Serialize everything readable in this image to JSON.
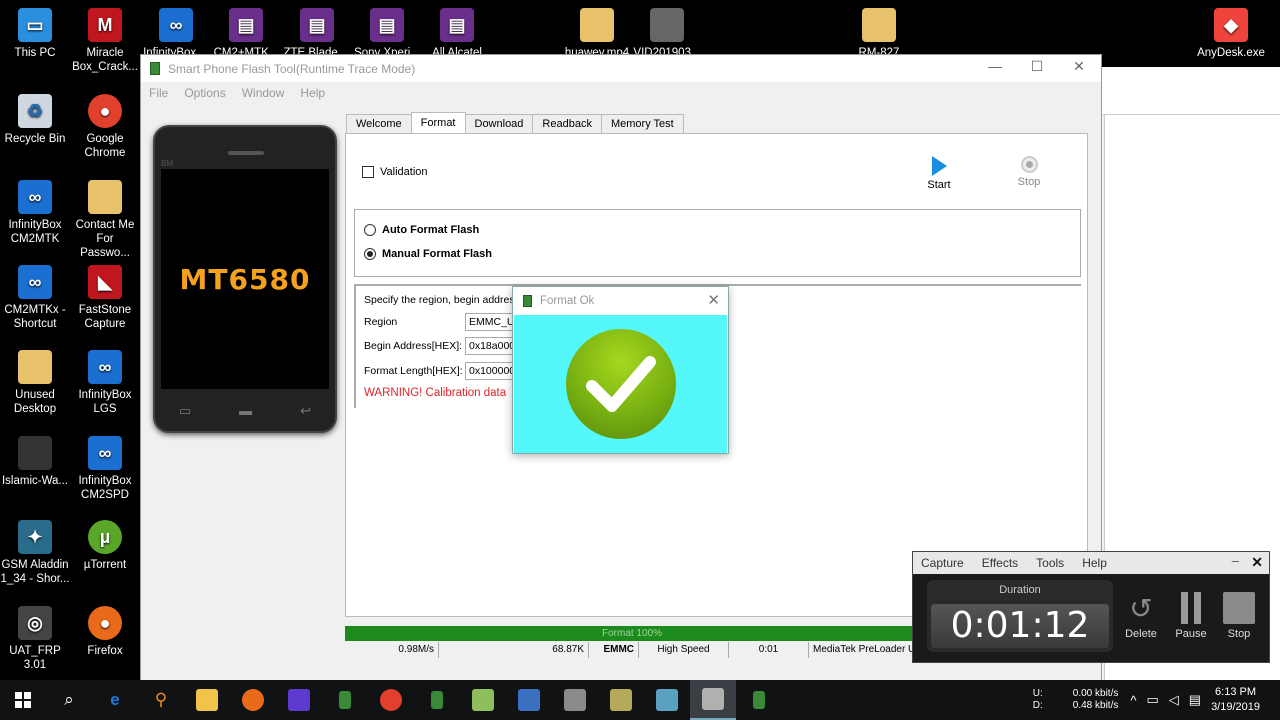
{
  "desktop": {
    "top_icons": [
      {
        "label": "This PC",
        "color": "#2b8fe0"
      },
      {
        "label": "Miracle Box_Crack...",
        "color": "#c0161f"
      },
      {
        "label": "InfinityBox ...",
        "color": "#1b6fd0"
      },
      {
        "label": "CM2+MTK...",
        "color": "#6a2f8a"
      },
      {
        "label": "ZTE Blade ...",
        "color": "#6a2f8a"
      },
      {
        "label": "Sony Xperi...",
        "color": "#6a2f8a"
      },
      {
        "label": "All Alcatel",
        "color": "#6a2f8a"
      },
      {
        "label": "huawey.mp4",
        "color": "#e8c26a"
      },
      {
        "label": "VID201903...",
        "color": "#666666"
      },
      {
        "label": "RM-827",
        "color": "#e8c26a"
      },
      {
        "label": "AnyDesk.exe",
        "color": "#ef443b"
      }
    ],
    "left_col1": [
      {
        "label": "Recycle Bin",
        "color": "#cfd8e0"
      },
      {
        "label": "InfinityBox CM2MTK",
        "color": "#1b6fd0"
      },
      {
        "label": "CM2MTKx - Shortcut",
        "color": "#1b6fd0"
      },
      {
        "label": "Unused Desktop",
        "color": "#e8c26a"
      },
      {
        "label": "Islamic-Wa...",
        "color": "#333333"
      },
      {
        "label": "GSM Aladdin 1_34 - Shor...",
        "color": "#2a6a8a"
      },
      {
        "label": "UAT_FRP 3.01",
        "color": "#444444"
      }
    ],
    "left_col2": [
      {
        "label": "Google Chrome",
        "color": "#e0402c"
      },
      {
        "label": "Contact Me For Passwo...",
        "color": "#e8c26a"
      },
      {
        "label": "FastStone Capture",
        "color": "#c0161f"
      },
      {
        "label": "InfinityBox LGS",
        "color": "#1b6fd0"
      },
      {
        "label": "InfinityBox CM2SPD",
        "color": "#1b6fd0"
      },
      {
        "label": "µTorrent",
        "color": "#5aa62a"
      },
      {
        "label": "Firefox",
        "color": "#e86a1a"
      }
    ]
  },
  "window": {
    "title": "Smart Phone Flash Tool(Runtime Trace Mode)",
    "menu": [
      "File",
      "Options",
      "Window",
      "Help"
    ],
    "phone_chip": "MT6580",
    "phone_brand": "BM",
    "tabs": [
      "Welcome",
      "Format",
      "Download",
      "Readback",
      "Memory Test"
    ],
    "validation_label": "Validation",
    "start_label": "Start",
    "stop_label": "Stop",
    "auto_format": "Auto Format Flash",
    "manual_format": "Manual Format Flash",
    "region_intro": "Specify the region, begin address",
    "region_label": "Region",
    "region_value": "EMMC_USE",
    "begin_label": "Begin Address[HEX]:",
    "begin_value": "0x18a000",
    "length_label": "Format Length[HEX]:",
    "length_value": "0x100000",
    "warning": "WARNING! Calibration data",
    "progress_text": "Format 100%",
    "progress_fraction": 1.0,
    "status": {
      "speed": "0.98M/s",
      "size": "68.87K",
      "storage": "EMMC",
      "mode": "High Speed",
      "time": "0:01",
      "port": "MediaTek PreLoader U"
    }
  },
  "dialog": {
    "title": "Format Ok",
    "bg_color": "#54f8fa"
  },
  "recorder": {
    "menu": [
      "Capture",
      "Effects",
      "Tools",
      "Help"
    ],
    "duration_label": "Duration",
    "time": "0:01:12",
    "delete_label": "Delete",
    "pause_label": "Pause",
    "stop_label": "Stop"
  },
  "taskbar": {
    "net_up_label": "U:",
    "net_up": "0.00 kbit/s",
    "net_down_label": "D:",
    "net_down": "0.48 kbit/s",
    "time": "6:13 PM",
    "date": "3/19/2019"
  }
}
